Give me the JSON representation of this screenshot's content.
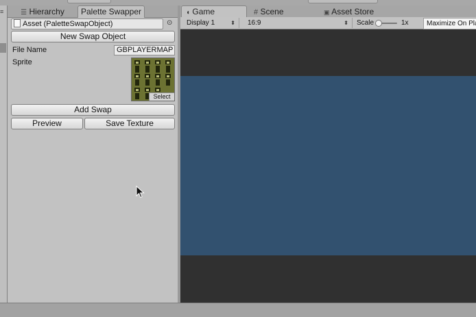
{
  "left_panel": {
    "tabs": [
      {
        "label": "Hierarchy",
        "icon": "hierarchy-icon",
        "active": false
      },
      {
        "label": "Palette Swapper",
        "active": true
      }
    ],
    "asset_field": {
      "value": "Asset (PaletteSwapObject)"
    },
    "new_swap_button": "New Swap Object",
    "file_name": {
      "label": "File Name",
      "value": "GBPLAYERMAP"
    },
    "sprite": {
      "label": "Sprite",
      "select_label": "Select"
    },
    "add_swap_button": "Add Swap",
    "preview_button": "Preview",
    "save_texture_button": "Save Texture"
  },
  "right_panel": {
    "tabs": [
      {
        "label": "Game",
        "icon": "game-icon",
        "active": true
      },
      {
        "label": "Scene",
        "icon": "scene-grid-icon",
        "active": false
      },
      {
        "label": "Asset Store",
        "icon": "asset-store-icon",
        "active": false
      }
    ],
    "toolbar": {
      "display": "Display 1",
      "aspect": "16:9",
      "scale_label": "Scale",
      "scale_value": "1x",
      "maximize": "Maximize On Pla"
    }
  },
  "colors": {
    "game_view": "#32516f",
    "game_background": "#303030",
    "panel": "#c2c2c2"
  }
}
